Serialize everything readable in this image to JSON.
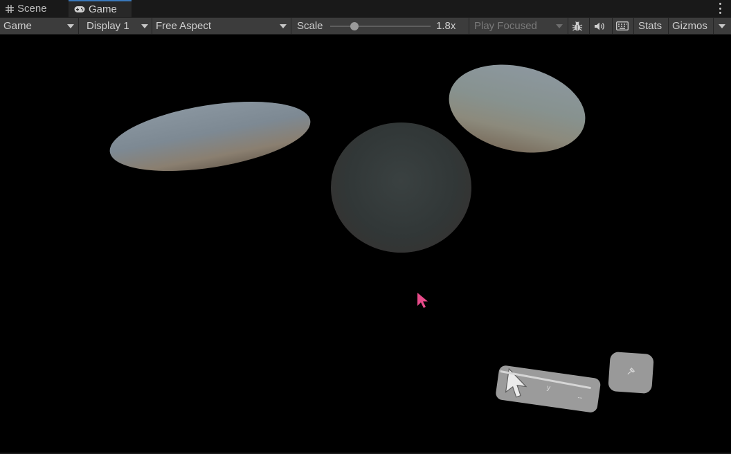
{
  "tabs": [
    {
      "label": "Scene",
      "icon": "grid-icon",
      "active": false
    },
    {
      "label": "Game",
      "icon": "gamepad-icon",
      "active": true
    }
  ],
  "toolbar": {
    "view_select": "Game",
    "display_select": "Display 1",
    "aspect_select": "Free Aspect",
    "scale_label": "Scale",
    "scale_value": "1.8x",
    "scale_fraction": 0.24,
    "play_mode_select": "Play Focused",
    "stats_label": "Stats",
    "gizmos_label": "Gizmos",
    "icons": [
      "bug-icon",
      "speaker-icon",
      "keyboard-icon"
    ]
  },
  "overlay": {
    "panel_glyphs": [
      "y",
      "--"
    ],
    "button_icon": "pin-icon"
  },
  "colors": {
    "tab_active_accent": "#3a79bb",
    "toolbar_bg": "#3c3c3c",
    "cursor_pink": "#e84b8a"
  }
}
